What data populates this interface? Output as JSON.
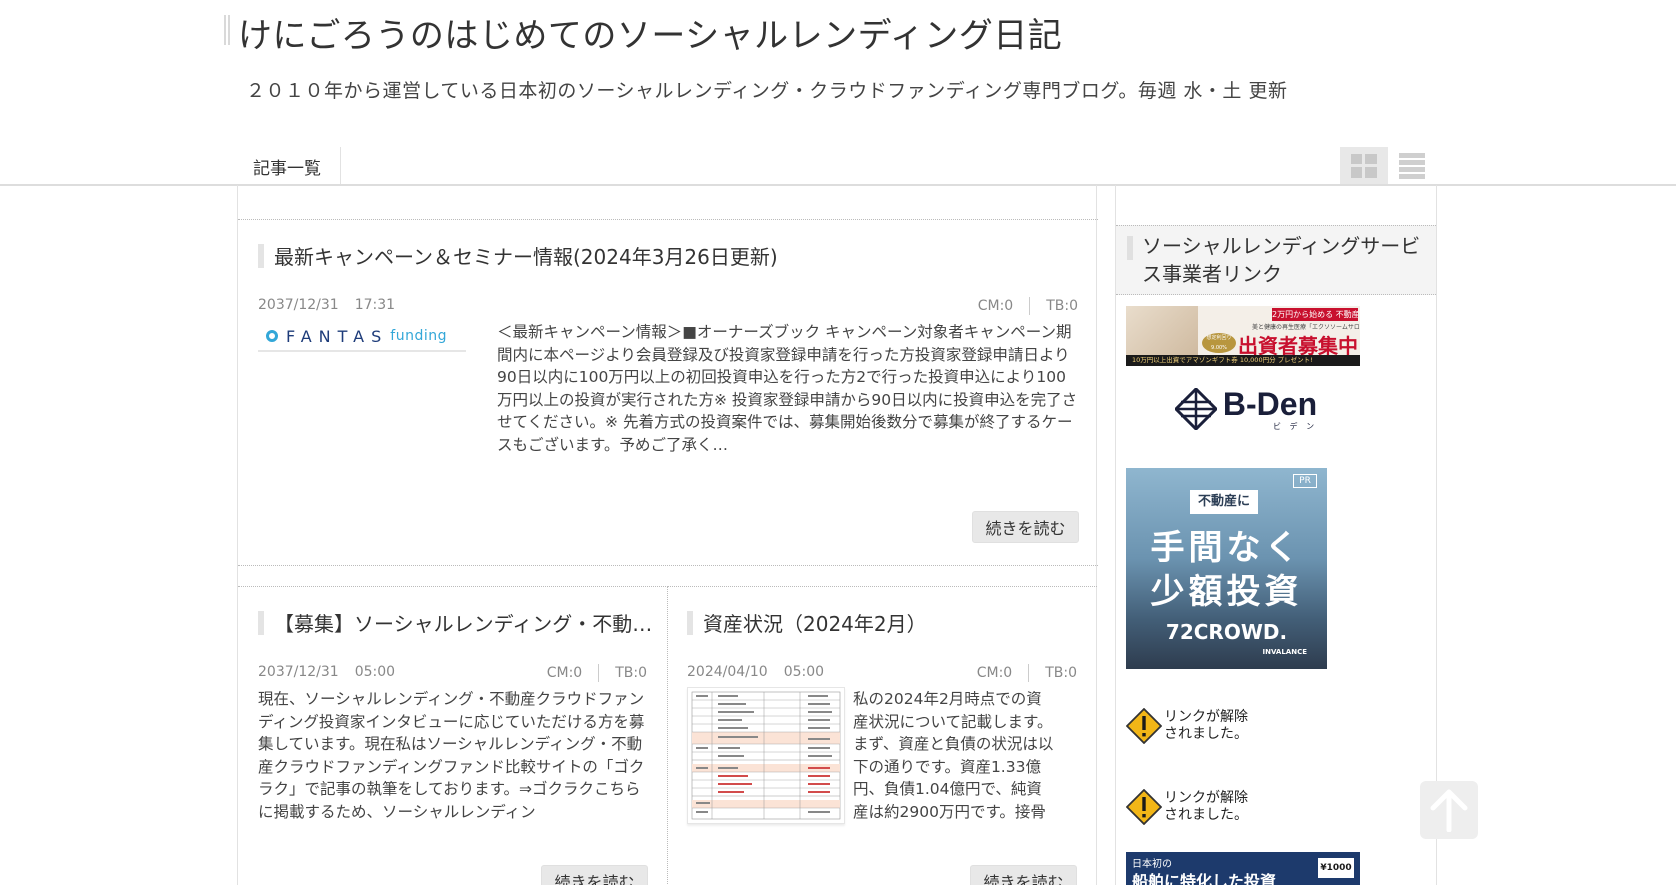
{
  "header": {
    "title": "けにごろうのはじめてのソーシャルレンディング日記",
    "description": "２０１０年から運営している日本初のソーシャルレンディング・クラウドファンディング専門ブログ。毎週 水・土 更新"
  },
  "nav": {
    "items": [
      {
        "label": "記事一覧"
      }
    ],
    "view_modes": [
      {
        "icon": "grid-view-icon"
      },
      {
        "icon": "list-view-icon"
      }
    ]
  },
  "articles": [
    {
      "title": "最新キャンペーン＆セミナー情報(2024年3月26日更新)",
      "date": "2037/12/31",
      "time": "17:31",
      "cm": "CM:0",
      "tb": "TB:0",
      "thumb_logo": {
        "main": "FANTAS",
        "sub": "funding"
      },
      "excerpt": "＜最新キャンペーン情報＞■オーナーズブック キャンペーン対象者キャンペーン期間内に本ページより会員登録及び投資家登録申請を行った方投資家登録申請日より90日以内に100万円以上の初回投資申込を行った方2で行った投資申込により100万円以上の投資が実行された方※ 投資家登録申請から90日以内に投資申込を完了させてください。※ 先着方式の投資案件では、募集開始後数分で募集が終了するケースもございます。予めご了承く…",
      "read_more": "続きを読む"
    },
    {
      "title": "【募集】ソーシャルレンディング・不動産クラウドファンディング投資家インタビュー",
      "date": "2037/12/31",
      "time": "05:00",
      "cm": "CM:0",
      "tb": "TB:0",
      "excerpt": "現在、ソーシャルレンディング・不動産クラウドファンディング投資家インタビューに応じていただける方を募集しています。現在私はソーシャルレンディング・不動産クラウドファンディングファンド比較サイトの「ゴクラク」で記事の執筆をしております。⇒ゴクラクこちらに掲載するため、ソーシャルレンディン",
      "read_more": "続きを読む"
    },
    {
      "title": "資産状況（2024年2月）",
      "date": "2024/04/10",
      "time": "05:00",
      "cm": "CM:0",
      "tb": "TB:0",
      "excerpt": "私の2024年2月時点での資産状況について記載します。まず、資産と負債の状況は以下の通りです。資産1.33億円、負債1.04億円で、純資産は約2900万円です。接骨",
      "read_more": "続きを読む"
    }
  ],
  "sidebar": {
    "heading": "ソーシャルレンディングサービス事業者リンク",
    "banners": {
      "realestate": {
        "top": "2万円から始める 不動産投資",
        "mid": "美と健康の再生医療「エクソソームサロン」",
        "main": "出資者募集中!",
        "badge": "想定利回り 9.00%",
        "bottom": "10万円以上出資でアマゾンギフト券 10,000円分 プレゼント!"
      },
      "bden": {
        "name": "B-Den",
        "kana": "ビ デ ン"
      },
      "crowd72": {
        "tag": "不動産に",
        "line1": "手間なく",
        "line2": "少額投資",
        "brand": "72CROWD.",
        "pr": "PR",
        "maker": "INVALANCE"
      },
      "removed_text": "リンクが解除されました。",
      "ship": {
        "tag": "日本初の",
        "main": "船舶に特化した投資",
        "gift": "¥1000"
      }
    }
  },
  "colors": {
    "text": "#333333",
    "meta": "#888888",
    "border": "#e2e2e2",
    "fantas_blue": "#1e3c7a",
    "fantas_cyan": "#33a7d8",
    "banner_red": "#c8102e",
    "ship_navy": "#1d3a6c"
  }
}
